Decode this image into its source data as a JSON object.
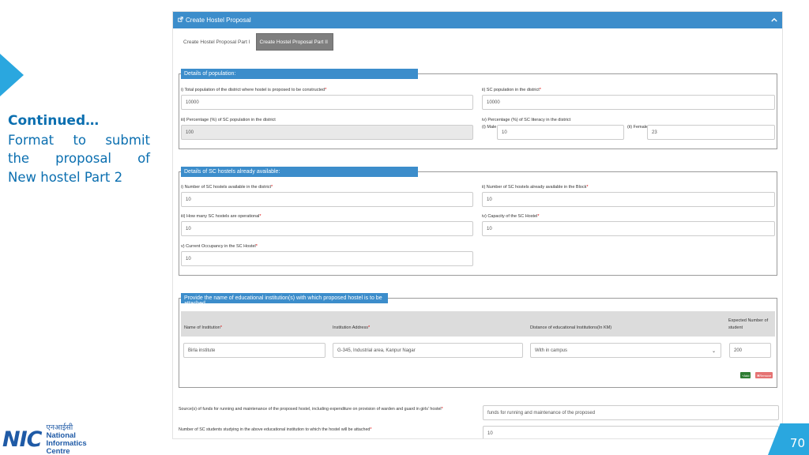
{
  "slide": {
    "heading": "Continued…",
    "lines": [
      "Format to submit",
      "the proposal of",
      "New hostel Part 2"
    ],
    "page_number": "70",
    "logo_mark": "NIC",
    "logo_hindi": "एनआईसी",
    "logo_line1": "National",
    "logo_line2": "Informatics",
    "logo_line3": "Centre",
    "accent_color": "#2aa7df"
  },
  "app": {
    "header_title": "Create Hostel Proposal",
    "header_icon": "external-link-icon",
    "collapse_icon": "chevron-up-icon",
    "tabs": [
      "Create Hostel Proposal Part I",
      "Create Hostel Proposal Part II"
    ],
    "active_tab": 1
  },
  "population": {
    "legend": "Details of population:",
    "total_label": "i) Total population of the district where hostel is proposed to be constructed",
    "total_value": "10000",
    "sc_label": "ii) SC population in the district",
    "sc_value": "10000",
    "pct_label": "iii) Percentage (%) of SC population in the district",
    "pct_value": "100",
    "literacy_label": "iv) Percentage (%) of SC literacy in the district",
    "male_label": "(i) Male",
    "male_value": "10",
    "female_label": "(ii) Female",
    "female_value": "23"
  },
  "hostels": {
    "legend": "Details of SC hostels already available:",
    "district_label": "i) Number of SC hostels available in the district",
    "district_value": "10",
    "block_label": "ii) Number of SC hostels already available in the Block",
    "block_value": "10",
    "operational_label": "iii) How many SC hostels are operational",
    "operational_value": "10",
    "capacity_label": "iv) Capacity of the SC Hostel",
    "capacity_value": "10",
    "occupancy_label": "v) Current Occupancy in the SC Hostel",
    "occupancy_value": "10"
  },
  "institutions": {
    "legend": "Provide the name of educational institution(s) with which proposed hostel is to be attached",
    "columns": [
      "Name of Institution",
      "Institution Address",
      "Distance of educational Institutions(In KM)",
      "Expected Number of student"
    ],
    "row": {
      "name": "Birla institute",
      "address": "G-345, Industrial area, Kanpur Nagar",
      "distance": "With in campus",
      "students": "200"
    },
    "add_label": "+Add",
    "remove_label": "✖Remove"
  },
  "funds": {
    "label": "Source(s) of funds for running and maintenance of the proposed hostel, including expenditure on provision of warden and guard in girls' hostel",
    "value": "funds for running and maintenance of the proposed",
    "students_label": "Number of SC students studying in the above educational institution to which the hostel will be attached",
    "students_value": "10"
  }
}
